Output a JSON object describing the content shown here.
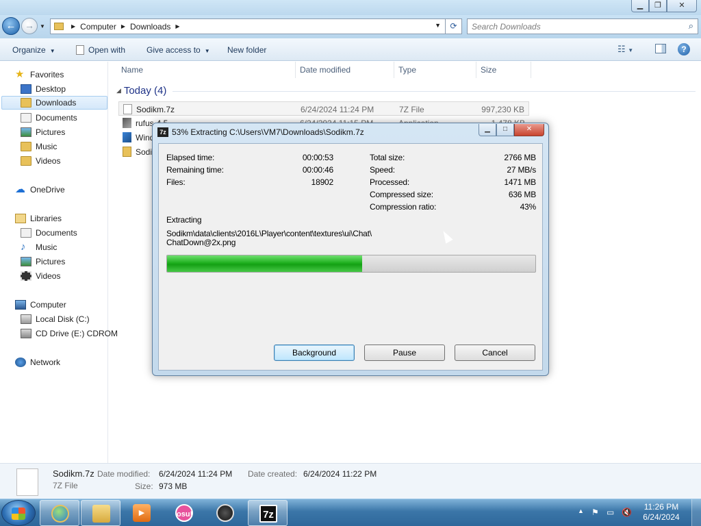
{
  "explorer": {
    "breadcrumb": [
      "Computer",
      "Downloads"
    ],
    "search_placeholder": "Search Downloads",
    "toolbar": {
      "organize": "Organize",
      "open_with": "Open with",
      "give_access": "Give access to",
      "new_folder": "New folder"
    },
    "nav": {
      "favorites": "Favorites",
      "fav_items": [
        "Desktop",
        "Downloads",
        "Documents",
        "Pictures",
        "Music",
        "Videos"
      ],
      "onedrive": "OneDrive",
      "libraries": "Libraries",
      "lib_items": [
        "Documents",
        "Music",
        "Pictures",
        "Videos"
      ],
      "computer": "Computer",
      "comp_items": [
        "Local Disk (C:)",
        "CD Drive (E:) CDROM"
      ],
      "network": "Network"
    },
    "columns": {
      "name": "Name",
      "date": "Date modified",
      "type": "Type",
      "size": "Size"
    },
    "group_label": "Today (4)",
    "files": [
      {
        "name": "Sodikm.7z",
        "date": "6/24/2024 11:24 PM",
        "type": "7Z File",
        "size": "997,230 KB",
        "icon": "file-icon"
      },
      {
        "name": "rufus-4.5",
        "date": "6/24/2024 11:15 PM",
        "type": "Application",
        "size": "1,478 KB",
        "icon": "application-icon"
      },
      {
        "name": "Wind",
        "date": "",
        "type": "",
        "size": "",
        "icon": "windows-icon"
      },
      {
        "name": "Sodi",
        "date": "",
        "type": "",
        "size": "",
        "icon": "folder-icon"
      }
    ],
    "details": {
      "name": "Sodikm.7z",
      "type": "7Z File",
      "date_modified_label": "Date modified:",
      "date_modified": "6/24/2024 11:24 PM",
      "date_created_label": "Date created:",
      "date_created": "6/24/2024 11:22 PM",
      "size_label": "Size:",
      "size": "973 MB"
    }
  },
  "dialog": {
    "title": "53% Extracting C:\\Users\\VM7\\Downloads\\Sodikm.7z",
    "icon_text": "7z",
    "elapsed_label": "Elapsed time:",
    "elapsed": "00:00:53",
    "remaining_label": "Remaining time:",
    "remaining": "00:00:46",
    "files_label": "Files:",
    "files": "18902",
    "total_label": "Total size:",
    "total": "2766 MB",
    "speed_label": "Speed:",
    "speed": "27 MB/s",
    "processed_label": "Processed:",
    "processed": "1471 MB",
    "compressed_label": "Compressed size:",
    "compressed": "636 MB",
    "ratio_label": "Compression ratio:",
    "ratio": "43%",
    "operation": "Extracting",
    "path_line1": "Sodikm\\data\\clients\\2016L\\Player\\content\\textures\\ui\\Chat\\",
    "path_line2": "ChatDown@2x.png",
    "progress": 0.53,
    "buttons": {
      "background": "Background",
      "pause": "Pause",
      "cancel": "Cancel"
    }
  },
  "taskbar": {
    "apps": [
      "internet-explorer-icon",
      "file-explorer-icon",
      "media-player-icon",
      "osu-icon",
      "obs-icon",
      "7zip-icon"
    ],
    "osu_text": "osu!",
    "sevenzip_text": "7z",
    "time": "11:26 PM",
    "date": "6/24/2024"
  },
  "colors": {
    "accent": "#1e3287",
    "progress": "#1fb01f"
  }
}
